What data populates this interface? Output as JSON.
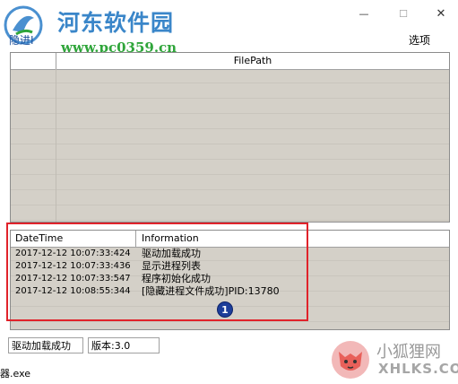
{
  "watermark": {
    "site_name": "河东软件园",
    "site_url": "www.pc0359.cn",
    "corner_text_1": "小狐狸网",
    "corner_text_2": "XHLKS.COM"
  },
  "window": {
    "controls": {
      "minimize": "—",
      "maximize": "☐",
      "close": "✕"
    }
  },
  "menu": {
    "left_item": "隐进I",
    "right_item": "选项"
  },
  "upper_list": {
    "columns": [
      "",
      "FilePath"
    ]
  },
  "lower_list": {
    "columns": [
      "DateTime",
      "Information"
    ],
    "rows": [
      {
        "datetime": "2017-12-12 10:07:33:424",
        "info": "驱动加载成功"
      },
      {
        "datetime": "2017-12-12 10:07:33:436",
        "info": "显示进程列表"
      },
      {
        "datetime": "2017-12-12 10:07:33:547",
        "info": "程序初始化成功"
      },
      {
        "datetime": "2017-12-12 10:08:55:344",
        "info": "[隐藏进程文件成功]PID:13780"
      }
    ]
  },
  "annotation": {
    "badge": "1",
    "color": "#e0222a"
  },
  "status": {
    "driver": "驱动加载成功",
    "version": "版本:3.0"
  },
  "taskbar": {
    "label": "器.exe"
  }
}
